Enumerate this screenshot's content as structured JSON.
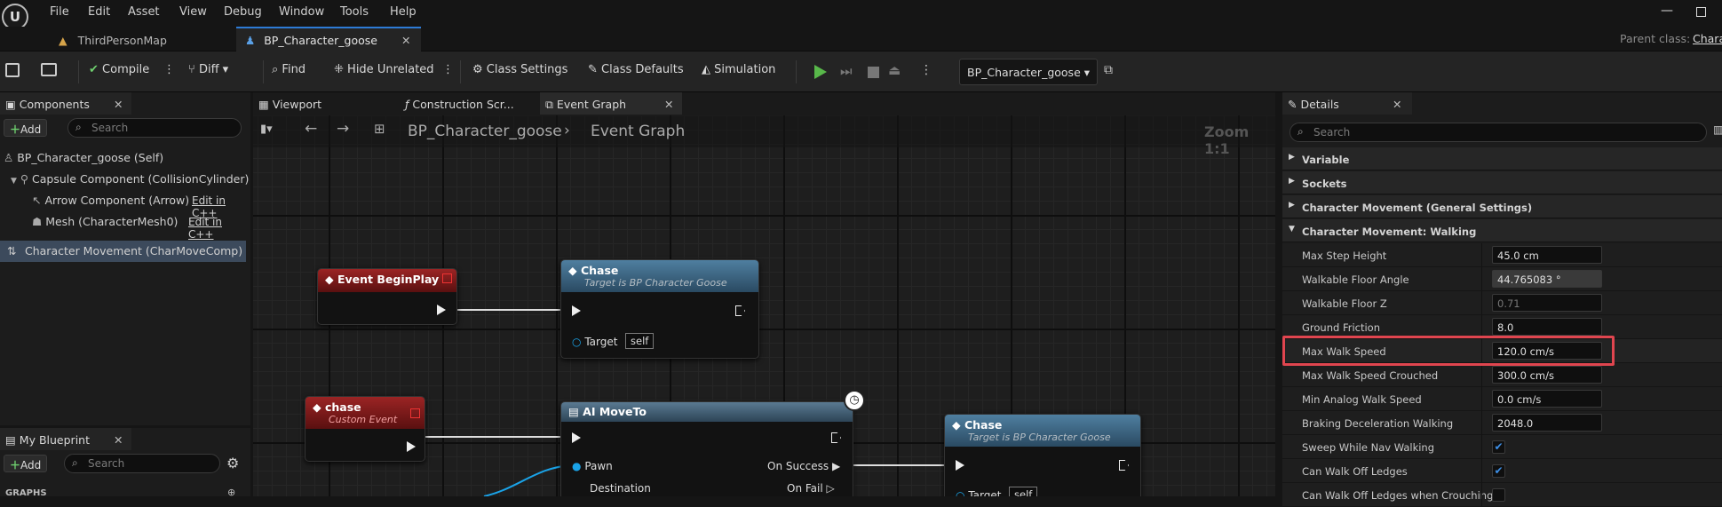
{
  "menu": [
    "File",
    "Edit",
    "Asset",
    "View",
    "Debug",
    "Window",
    "Tools",
    "Help"
  ],
  "tabs": [
    {
      "label": "ThirdPersonMap"
    },
    {
      "label": "BP_Character_goose"
    }
  ],
  "parent_class": {
    "label": "Parent class:",
    "value": "Chara"
  },
  "toolbar": {
    "compile": "Compile",
    "diff": "Diff",
    "find": "Find",
    "hide_unrelated": "Hide Unrelated",
    "class_settings": "Class Settings",
    "class_defaults": "Class Defaults",
    "simulation": "Simulation",
    "debug_object": "BP_Character_goose"
  },
  "components": {
    "tab": "Components",
    "add": "Add",
    "search": "Search",
    "items": [
      {
        "label": "BP_Character_goose (Self)"
      },
      {
        "label": "Capsule Component (CollisionCylinder)"
      },
      {
        "label": "Arrow Component (Arrow)",
        "link": "Edit in C++"
      },
      {
        "label": "Mesh (CharacterMesh0)",
        "link": "Edit in C++"
      },
      {
        "label": "Character Movement (CharMoveComp)"
      }
    ]
  },
  "my_blueprint": {
    "tab": "My Blueprint",
    "add": "Add",
    "search": "Search",
    "section": "GRAPHS"
  },
  "graph_tabs": [
    "Viewport",
    "Construction Scr...",
    "Event Graph"
  ],
  "breadcrumb": {
    "blueprint": "BP_Character_goose",
    "graph": "Event Graph",
    "zoom": "Zoom 1:1"
  },
  "nodes": {
    "begin_play": {
      "title": "Event BeginPlay"
    },
    "chase_call_1": {
      "title": "Chase",
      "subtitle": "Target is BP Character Goose",
      "target": "Target",
      "target_value": "self"
    },
    "chase_event": {
      "title": "chase",
      "subtitle": "Custom Event"
    },
    "ai_moveto": {
      "title": "AI MoveTo",
      "pawn": "Pawn",
      "destination": "Destination",
      "on_success": "On Success",
      "on_fail": "On Fail"
    },
    "chase_call_2": {
      "title": "Chase",
      "subtitle": "Target is BP Character Goose",
      "target": "Target",
      "target_value": "self"
    }
  },
  "details": {
    "tab": "Details",
    "search": "Search",
    "categories": [
      "Variable",
      "Sockets",
      "Character Movement (General Settings)",
      "Character Movement: Walking"
    ],
    "props": [
      {
        "label": "Max Step Height",
        "value": "45.0 cm"
      },
      {
        "label": "Walkable Floor Angle",
        "value": "44.765083 °"
      },
      {
        "label": "Walkable Floor Z",
        "value": "0.71"
      },
      {
        "label": "Ground Friction",
        "value": "8.0"
      },
      {
        "label": "Max Walk Speed",
        "value": "120.0 cm/s"
      },
      {
        "label": "Max Walk Speed Crouched",
        "value": "300.0 cm/s"
      },
      {
        "label": "Min Analog Walk Speed",
        "value": "0.0 cm/s"
      },
      {
        "label": "Braking Deceleration Walking",
        "value": "2048.0"
      },
      {
        "label": "Sweep While Nav Walking",
        "checked": true
      },
      {
        "label": "Can Walk Off Ledges",
        "checked": true
      },
      {
        "label": "Can Walk Off Ledges when Crouching",
        "checked": false
      }
    ]
  },
  "colors": {
    "accent": "#2d7bd6",
    "highlight": "#e0454f",
    "event_node": "#8b1a1a",
    "function_node": "#3b6a8a"
  }
}
